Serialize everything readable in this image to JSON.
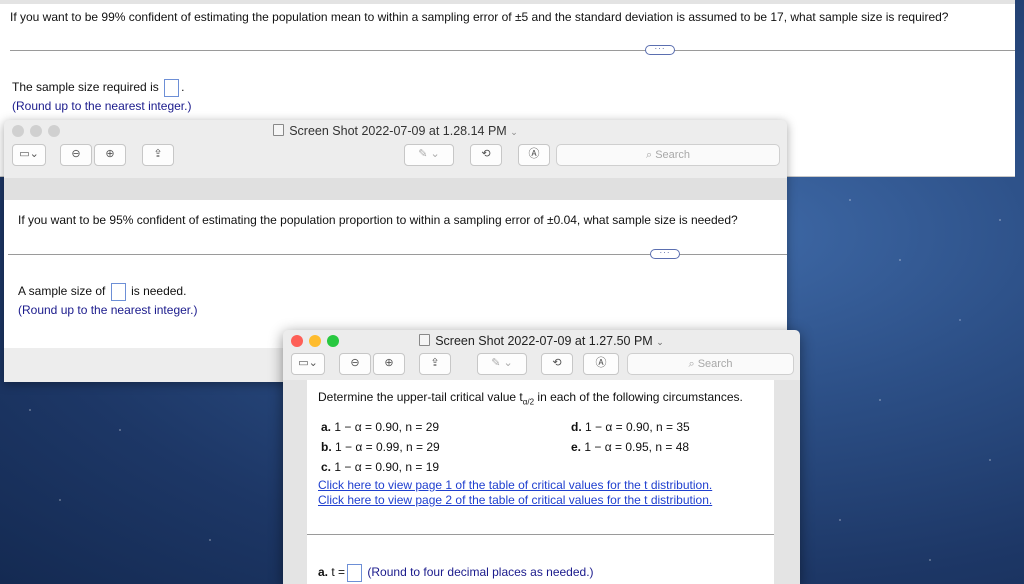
{
  "window1": {
    "question": "If you want to be 99% confident of estimating the population mean to within a sampling error of ±5 and the standard deviation is assumed to be 17, what sample size is required?",
    "ellipsis": "···",
    "answer_prefix": "The sample size required is",
    "answer_suffix": ".",
    "hint": "(Round up to the nearest integer.)"
  },
  "window2": {
    "title": "Screen Shot 2022-07-09 at 1.28.14 PM",
    "search_placeholder": "Search",
    "question": "If you want to be 95% confident of estimating the population proportion to within a sampling error of ±0.04, what sample size is needed?",
    "ellipsis": "···",
    "answer_prefix": "A sample size of",
    "answer_suffix": "is needed.",
    "hint": "(Round up to the nearest integer.)"
  },
  "window3": {
    "title": "Screen Shot 2022-07-09 at 1.27.50 PM",
    "search_placeholder": "Search",
    "intro_before": "Determine the upper-tail critical value t",
    "intro_sub": "α/2",
    "intro_after": " in each of the following circumstances.",
    "items_left": [
      {
        "label": "a.",
        "text": "1 − α = 0.90, n = 29"
      },
      {
        "label": "b.",
        "text": "1 − α = 0.99, n = 29"
      },
      {
        "label": "c.",
        "text": "1 − α = 0.90, n = 19"
      }
    ],
    "items_right": [
      {
        "label": "d.",
        "text": "1 − α = 0.90, n = 35"
      },
      {
        "label": "e.",
        "text": "1 − α = 0.95, n = 48"
      }
    ],
    "link1": "Click here to view page 1 of the table of critical values for the t distribution.",
    "link2": "Click here to view page 2 of the table of critical values for the t distribution.",
    "answer_label": "a.",
    "answer_var": "t =",
    "answer_hint": "(Round to four decimal places as needed.)"
  },
  "colors": {
    "link": "#1f3fcf",
    "hint": "#1a1a8c",
    "close": "#fe5f57",
    "minimize": "#febc2e",
    "zoom": "#28c840"
  }
}
